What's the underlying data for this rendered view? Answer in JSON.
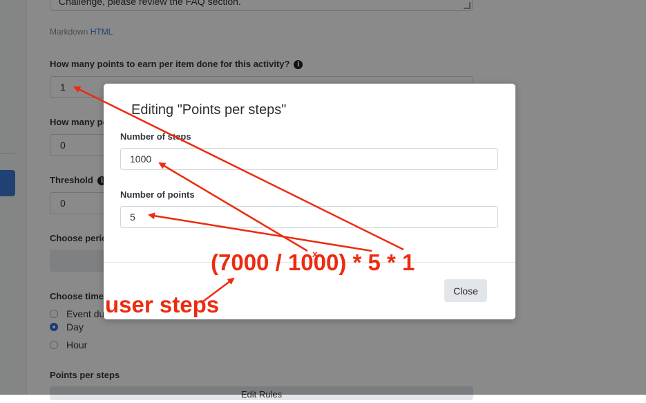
{
  "background": {
    "textarea_text": "Challenge, please review the FAQ section.",
    "format_label": "Markdown",
    "format_link": "HTML",
    "points_question": "How many points to earn per item done for this activity?",
    "points_value": "1",
    "second_question": "How many po",
    "second_value": "0",
    "threshold_label": "Threshold",
    "threshold_value": "0",
    "period_label": "Choose perio",
    "timeframe_label": "Choose timef",
    "radio_options": [
      {
        "label": "Event du",
        "checked": false
      },
      {
        "label": "Day",
        "checked": true
      },
      {
        "label": "Hour",
        "checked": false
      }
    ],
    "points_per_steps_label": "Points per steps",
    "bottom_button_label": "Edit Rules"
  },
  "modal": {
    "title": "Editing \"Points per steps\"",
    "steps_label": "Number of steps",
    "steps_value": "1000",
    "points_label": "Number of points",
    "points_value": "5",
    "close_label": "Close"
  },
  "annotation": {
    "formula": "(7000 / 1000) * 5 * 1",
    "user_steps": "user steps",
    "mark": "x",
    "color": "#ec2b10"
  },
  "icons": {
    "info": "info-icon",
    "arrow": "arrow-icon"
  }
}
